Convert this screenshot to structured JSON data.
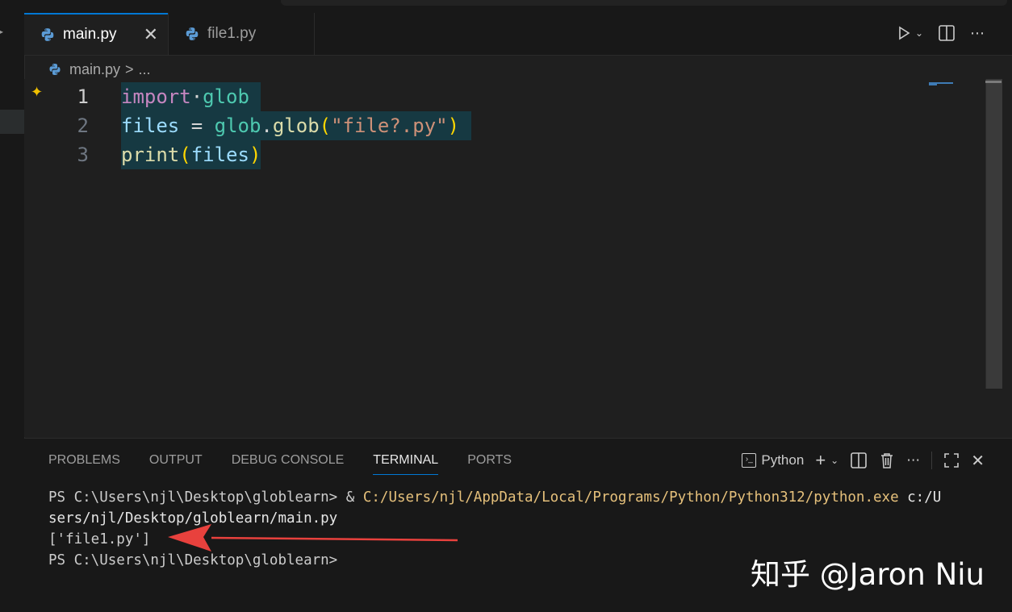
{
  "tabs": [
    {
      "label": "main.py",
      "active": true
    },
    {
      "label": "file1.py",
      "active": false
    }
  ],
  "editor_actions": {
    "run": "run-icon",
    "split": "split-editor-icon",
    "more": "more-icon"
  },
  "breadcrumb": {
    "file": "main.py",
    "separator": ">",
    "rest": "..."
  },
  "code_lines": [
    {
      "number": "1"
    },
    {
      "number": "2"
    },
    {
      "number": "3"
    }
  ],
  "code": {
    "l1_import": "import",
    "l1_module": "glob",
    "l2_var": "files",
    "l2_eq": "=",
    "l2_mod": "glob",
    "l2_dot": ".",
    "l2_fn": "glob",
    "l2_open": "(",
    "l2_str": "\"file?.py\"",
    "l2_close": ")",
    "l3_fn": "print",
    "l3_open": "(",
    "l3_var": "files",
    "l3_close": ")"
  },
  "panel": {
    "tabs": [
      "PROBLEMS",
      "OUTPUT",
      "DEBUG CONSOLE",
      "TERMINAL",
      "PORTS"
    ],
    "active_tab": "TERMINAL",
    "profile": "Python"
  },
  "terminal": {
    "prompt1": "PS C:\\Users\\njl\\Desktop\\globlearn> ",
    "amp": "& ",
    "exe": "C:/Users/njl/AppData/Local/Programs/Python/Python312/python.exe",
    "arg1": " c:/U",
    "arg2": "sers/njl/Desktop/globlearn/main.py",
    "output": "['file1.py']",
    "prompt2": "PS C:\\Users\\njl\\Desktop\\globlearn>"
  },
  "watermark": "知乎 @Jaron Niu",
  "colors": {
    "accent": "#0078d4",
    "annotation_arrow": "#e8413d",
    "selection": "#163942"
  }
}
